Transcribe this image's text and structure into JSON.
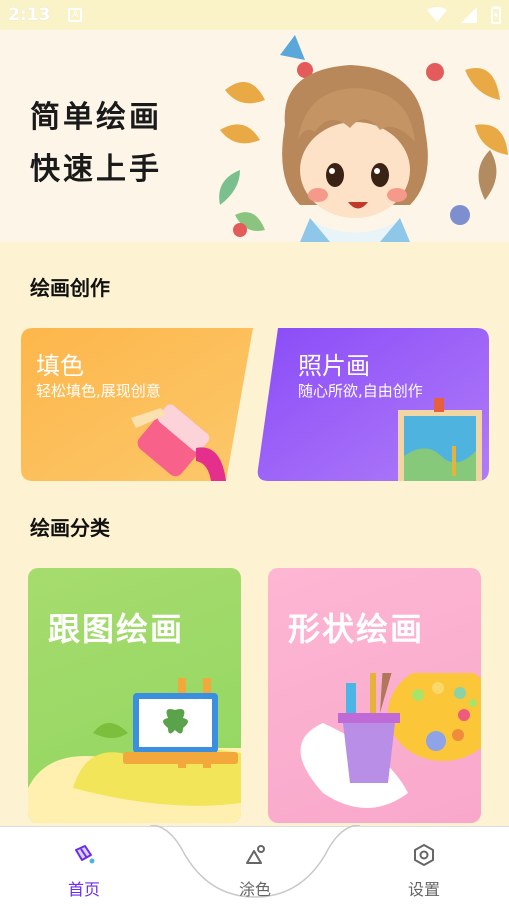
{
  "status_bar": {
    "time": "2:13",
    "sim_label": "A"
  },
  "hero": {
    "line1": "简单绘画",
    "line2": "快速上手"
  },
  "section_create": {
    "title": "绘画创作"
  },
  "card_fill": {
    "title": "填色",
    "subtitle": "轻松填色,展现创意"
  },
  "card_photo": {
    "title": "照片画",
    "subtitle": "随心所欲,自由创作"
  },
  "section_category": {
    "title": "绘画分类"
  },
  "card_trace": {
    "title": "跟图绘画"
  },
  "card_shape": {
    "title": "形状绘画"
  },
  "nav": {
    "home": "首页",
    "color": "涂色",
    "settings": "设置"
  },
  "colors": {
    "accent": "#6a2cf0",
    "fill_card": "#fdbb4a",
    "photo_card": "#9a57f7",
    "trace_card": "#9ed868",
    "shape_card": "#fbb1d0"
  },
  "icons": {
    "home": "paint-bucket-icon",
    "color": "shapes-icon",
    "settings": "gear-hex-icon"
  }
}
